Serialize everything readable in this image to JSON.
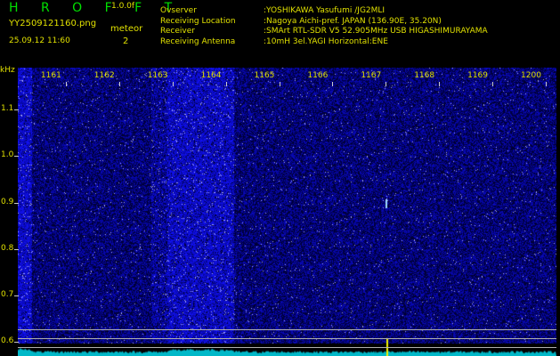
{
  "header": {
    "logo": "H R O F F T",
    "version": "1.0.0f",
    "filename": "YY2509121160.png",
    "mode": "meteor",
    "timestamp": "25.09.12 11:60",
    "count": "2"
  },
  "info": [
    {
      "key": "Ovserver",
      "value": ":YOSHIKAWA Yasufumi /JG2MLI"
    },
    {
      "key": "Receiving Location",
      "value": ":Nagoya Aichi-pref. JAPAN (136.90E, 35.20N)"
    },
    {
      "key": "Receiver",
      "value": ":SMArt RTL-SDR V5 52.905MHz USB HIGASHIMURAYAMA"
    },
    {
      "key": "Receiving Antenna",
      "value": ":10mH 3el.YAGI Horizontal:ENE"
    }
  ],
  "axis": {
    "unit": "kHz",
    "y_ticks": [
      {
        "label": "1.1",
        "value": 1.1
      },
      {
        "label": "1.0",
        "value": 1.0
      },
      {
        "label": "0.9",
        "value": 0.9
      },
      {
        "label": "0.8",
        "value": 0.8
      },
      {
        "label": "0.7",
        "value": 0.7
      },
      {
        "label": "0.6",
        "value": 0.6
      }
    ],
    "x_ticks": [
      {
        "label": "1161",
        "value": 1161
      },
      {
        "label": "1162",
        "value": 1162
      },
      {
        "label": "1163",
        "value": 1163
      },
      {
        "label": "1164",
        "value": 1164
      },
      {
        "label": "1165",
        "value": 1165
      },
      {
        "label": "1166",
        "value": 1166
      },
      {
        "label": "1167",
        "value": 1167
      },
      {
        "label": "1168",
        "value": 1168
      },
      {
        "label": "1169",
        "value": 1169
      },
      {
        "label": "1200",
        "value": 1170
      }
    ],
    "x_range": [
      1160.1,
      1170.2
    ],
    "y_range": [
      0.57,
      1.19
    ]
  },
  "colors": {
    "text": "#e0e000",
    "logo": "#00e000",
    "background_noise": "#101088",
    "active_noise": "#3a3aff",
    "spectrum": "#00d8e8",
    "lines": "#b0b0b0"
  }
}
